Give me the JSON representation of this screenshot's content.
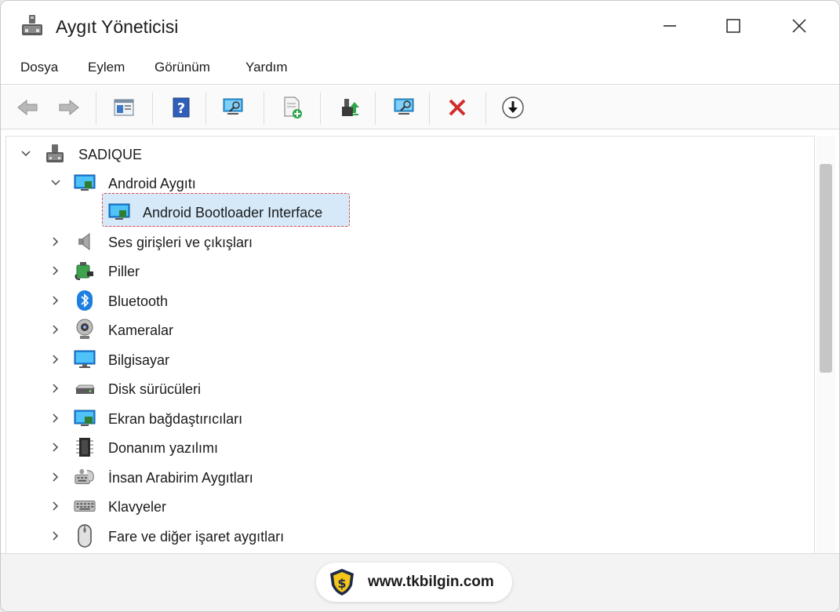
{
  "window": {
    "title": "Aygıt Yöneticisi",
    "controls": [
      "minimize-icon",
      "maximize-icon",
      "close-icon"
    ]
  },
  "menu": {
    "items": [
      "Dosya",
      "Eylem",
      "Görünüm",
      "Yardım"
    ]
  },
  "toolbar": {
    "buttons": [
      {
        "icon": "back-arrow-icon"
      },
      {
        "icon": "forward-arrow-icon"
      },
      {
        "icon": "properties-icon"
      },
      {
        "icon": "help-icon"
      },
      {
        "icon": "scan-hardware-icon"
      },
      {
        "icon": "add-legacy-hardware-icon"
      },
      {
        "icon": "update-driver-icon"
      },
      {
        "icon": "enable-device-icon"
      },
      {
        "icon": "uninstall-icon"
      },
      {
        "icon": "download-icon"
      }
    ]
  },
  "tree": {
    "root": {
      "label": "SADIQUE",
      "icon": "computer-tower-icon",
      "expanded": true
    },
    "nodes": [
      {
        "label": "Android Aygıtı",
        "icon": "android-device-icon",
        "expanded": true,
        "level": 1
      },
      {
        "label": "Android Bootloader Interface",
        "icon": "android-device-icon",
        "level": 2,
        "selected": true
      },
      {
        "label": "Ses girişleri ve çıkışları",
        "icon": "speaker-icon",
        "level": 1
      },
      {
        "label": "Piller",
        "icon": "battery-icon",
        "level": 1
      },
      {
        "label": "Bluetooth",
        "icon": "bluetooth-icon",
        "level": 1
      },
      {
        "label": "Kameralar",
        "icon": "webcam-icon",
        "level": 1
      },
      {
        "label": "Bilgisayar",
        "icon": "monitor-icon",
        "level": 1
      },
      {
        "label": "Disk sürücüleri",
        "icon": "disk-drive-icon",
        "level": 1
      },
      {
        "label": "Ekran bağdaştırıcıları",
        "icon": "display-adapter-icon",
        "level": 1
      },
      {
        "label": "Donanım yazılımı",
        "icon": "firmware-chip-icon",
        "level": 1
      },
      {
        "label": "İnsan Arabirim Aygıtları",
        "icon": "hid-icon",
        "level": 1
      },
      {
        "label": "Klavyeler",
        "icon": "keyboard-icon",
        "level": 1
      },
      {
        "label": "Fare ve diğer işaret aygıtları",
        "icon": "mouse-icon",
        "level": 1
      }
    ]
  },
  "watermark": {
    "text": "www.tkbilgin.com",
    "logo": "shield-dollar-logo"
  },
  "colors": {
    "selection_bg": "#d5e9f9",
    "selection_border": "#e0474c",
    "accent_blue": "#1e88e5",
    "delete_red": "#d12c2c"
  }
}
